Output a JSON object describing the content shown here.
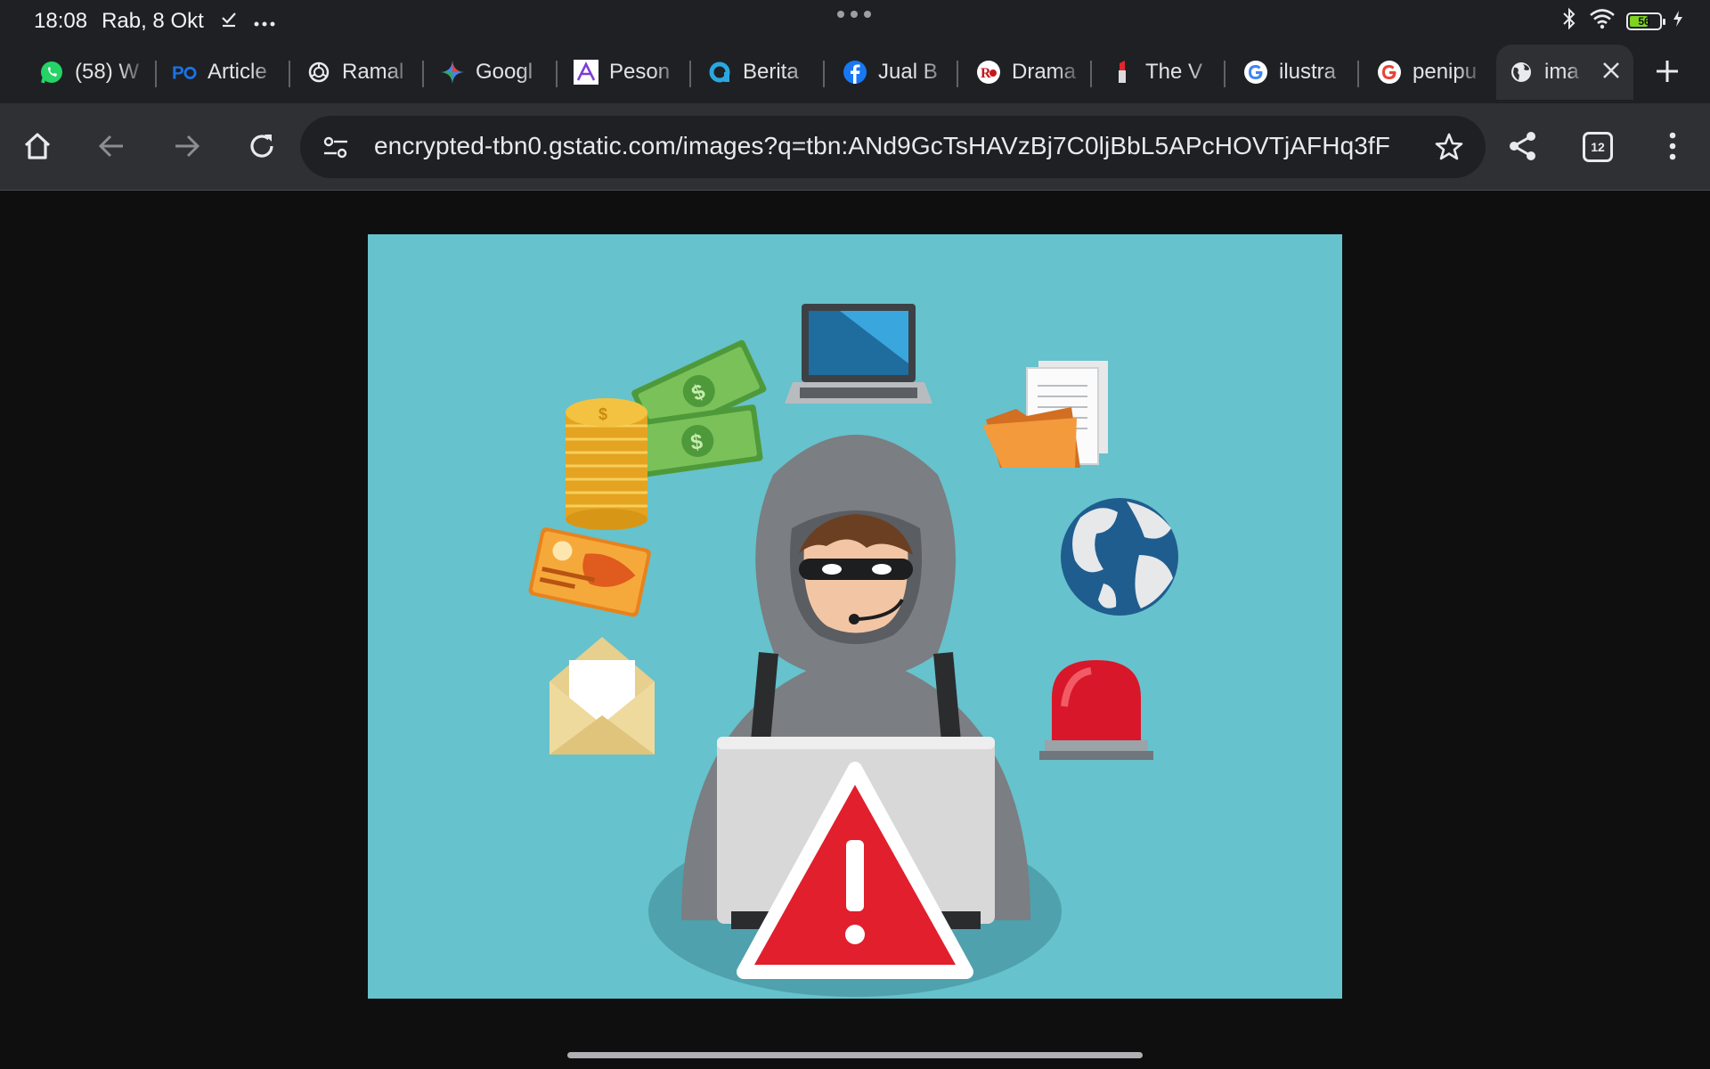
{
  "status_bar": {
    "time": "18:08",
    "date": "Rab, 8 Okt",
    "battery": "56",
    "icons": [
      "download-done-icon",
      "more-dots-icon",
      "bluetooth-icon",
      "wifi-icon",
      "battery-icon",
      "charging-icon"
    ]
  },
  "tabs": [
    {
      "title": "(58) W",
      "favicon": "whatsapp-icon"
    },
    {
      "title": "Article",
      "favicon": "po-icon"
    },
    {
      "title": "Ramal",
      "favicon": "openai-icon"
    },
    {
      "title": "Googl",
      "favicon": "gemini-icon"
    },
    {
      "title": "Peson",
      "favicon": "a-icon"
    },
    {
      "title": "Berita",
      "favicon": "beritasatu-icon"
    },
    {
      "title": "Jual B",
      "favicon": "facebook-icon"
    },
    {
      "title": "Drama",
      "favicon": "drama-icon"
    },
    {
      "title": "The V",
      "favicon": "lipstick-icon"
    },
    {
      "title": "ilustra",
      "favicon": "google-icon"
    },
    {
      "title": "penipu",
      "favicon": "google-icon"
    },
    {
      "title": "ima",
      "favicon": "globe-icon",
      "active": true
    }
  ],
  "toolbar": {
    "url": "encrypted-tbn0.gstatic.com/images?q=tbn:ANd9GcTsHAVzBj7C0ljBbL5APcHOVTjAFHq3fF",
    "tab_count": "12"
  },
  "colors": {
    "image_background": "#66c2cc",
    "toolbar": "#2f3033",
    "tabstrip": "#1f2023"
  }
}
